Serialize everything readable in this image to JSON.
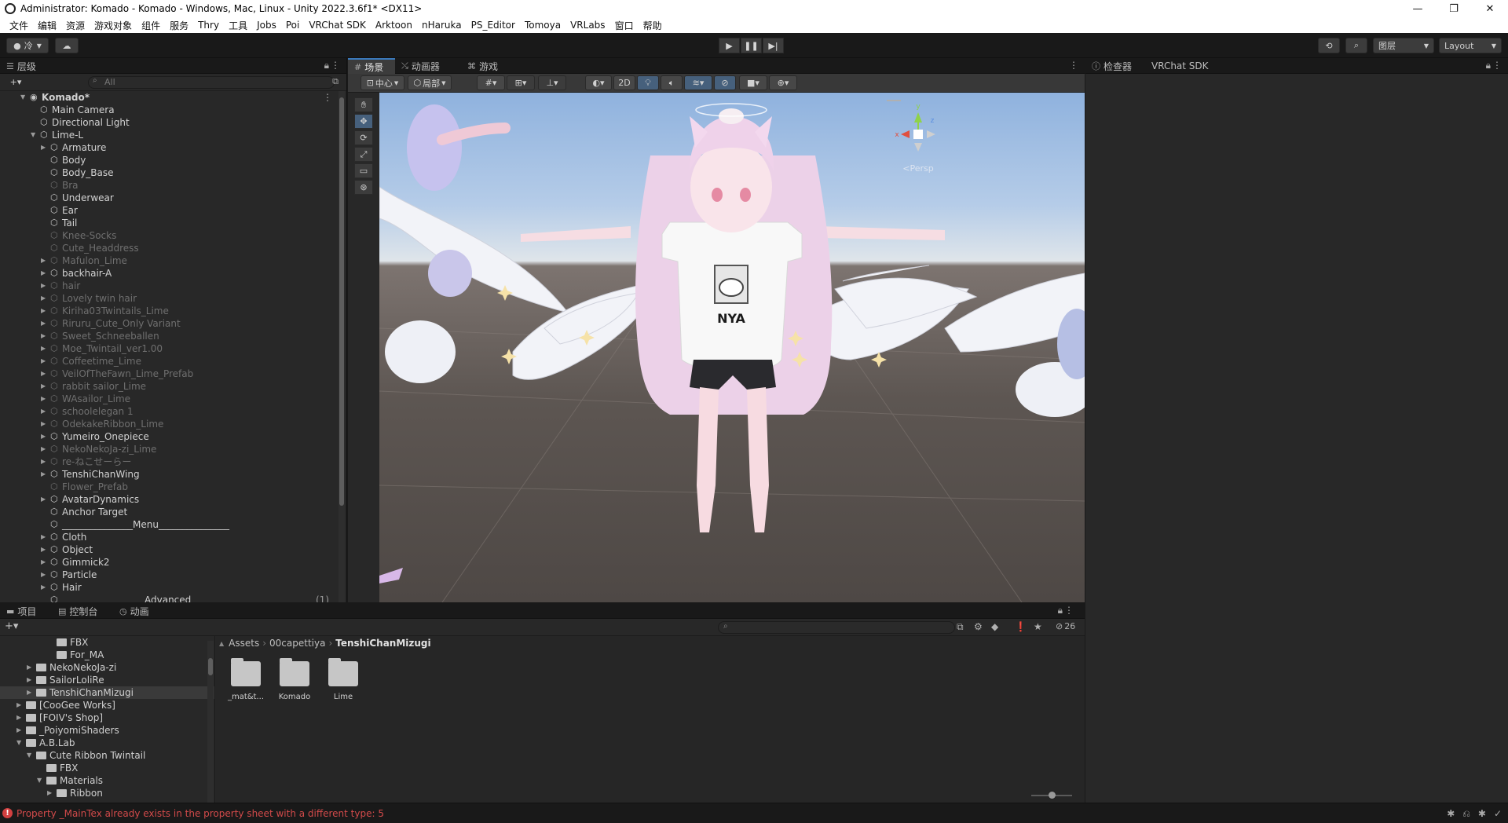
{
  "window": {
    "title": "Administrator: Komado - Komado - Windows, Mac, Linux - Unity 2022.3.6f1* <DX11>"
  },
  "menubar": {
    "items": [
      "文件",
      "编辑",
      "资源",
      "游戏对象",
      "组件",
      "服务",
      "Thry",
      "工具",
      "Jobs",
      "Poi",
      "VRChat SDK",
      "Arktoon",
      "nHaruka",
      "PS_Editor",
      "Tomoya",
      "VRLabs",
      "窗口",
      "帮助"
    ]
  },
  "toolbar": {
    "account_label": "冷",
    "layers_label": "图层",
    "layout_label": "Layout"
  },
  "hierarchy": {
    "tab_label": "层级",
    "search_placeholder": "All",
    "rows": [
      {
        "label": "Komado*",
        "depth": 0,
        "arrow": "▼",
        "dim": false,
        "scene": true
      },
      {
        "label": "Main Camera",
        "depth": 1,
        "arrow": "",
        "dim": false
      },
      {
        "label": "Directional Light",
        "depth": 1,
        "arrow": "",
        "dim": false
      },
      {
        "label": "Lime-L",
        "depth": 1,
        "arrow": "▼",
        "dim": false
      },
      {
        "label": "Armature",
        "depth": 2,
        "arrow": "▶",
        "dim": false
      },
      {
        "label": "Body",
        "depth": 2,
        "arrow": "",
        "dim": false
      },
      {
        "label": "Body_Base",
        "depth": 2,
        "arrow": "",
        "dim": false
      },
      {
        "label": "Bra",
        "depth": 2,
        "arrow": "",
        "dim": true
      },
      {
        "label": "Underwear",
        "depth": 2,
        "arrow": "",
        "dim": false
      },
      {
        "label": "Ear",
        "depth": 2,
        "arrow": "",
        "dim": false
      },
      {
        "label": "Tail",
        "depth": 2,
        "arrow": "",
        "dim": false
      },
      {
        "label": "Knee-Socks",
        "depth": 2,
        "arrow": "",
        "dim": true
      },
      {
        "label": "Cute_Headdress",
        "depth": 2,
        "arrow": "",
        "dim": true
      },
      {
        "label": "Mafulon_Lime",
        "depth": 2,
        "arrow": "▶",
        "dim": true
      },
      {
        "label": "backhair-A",
        "depth": 2,
        "arrow": "▶",
        "dim": false
      },
      {
        "label": "hair",
        "depth": 2,
        "arrow": "▶",
        "dim": true
      },
      {
        "label": "Lovely twin hair",
        "depth": 2,
        "arrow": "▶",
        "dim": true
      },
      {
        "label": "Kiriha03Twintails_Lime",
        "depth": 2,
        "arrow": "▶",
        "dim": true
      },
      {
        "label": "Riruru_Cute_Only Variant",
        "depth": 2,
        "arrow": "▶",
        "dim": true
      },
      {
        "label": "Sweet_Schneeballen",
        "depth": 2,
        "arrow": "▶",
        "dim": true
      },
      {
        "label": "Moe_Twintail_ver1.00",
        "depth": 2,
        "arrow": "▶",
        "dim": true
      },
      {
        "label": "Coffeetime_Lime",
        "depth": 2,
        "arrow": "▶",
        "dim": true
      },
      {
        "label": "VeilOfTheFawn_Lime_Prefab",
        "depth": 2,
        "arrow": "▶",
        "dim": true
      },
      {
        "label": "rabbit sailor_Lime",
        "depth": 2,
        "arrow": "▶",
        "dim": true
      },
      {
        "label": "WAsailor_Lime",
        "depth": 2,
        "arrow": "▶",
        "dim": true
      },
      {
        "label": "schoolelegan 1",
        "depth": 2,
        "arrow": "▶",
        "dim": true
      },
      {
        "label": "OdekakeRibbon_Lime",
        "depth": 2,
        "arrow": "▶",
        "dim": true
      },
      {
        "label": "Yumeiro_Onepiece",
        "depth": 2,
        "arrow": "▶",
        "dim": false
      },
      {
        "label": "NekoNekoJa-zi_Lime",
        "depth": 2,
        "arrow": "▶",
        "dim": true
      },
      {
        "label": "re-ねこせーらー",
        "depth": 2,
        "arrow": "▶",
        "dim": true
      },
      {
        "label": "TenshiChanWing",
        "depth": 2,
        "arrow": "▶",
        "dim": false
      },
      {
        "label": "Flower_Prefab",
        "depth": 2,
        "arrow": "",
        "dim": true
      },
      {
        "label": "AvatarDynamics",
        "depth": 2,
        "arrow": "▶",
        "dim": false
      },
      {
        "label": "Anchor Target",
        "depth": 2,
        "arrow": "",
        "dim": false
      },
      {
        "label": "_______________Menu_______________",
        "depth": 2,
        "arrow": "",
        "dim": false
      },
      {
        "label": "Cloth",
        "depth": 2,
        "arrow": "▶",
        "dim": false
      },
      {
        "label": "Object",
        "depth": 2,
        "arrow": "▶",
        "dim": false
      },
      {
        "label": "Gimmick2",
        "depth": 2,
        "arrow": "▶",
        "dim": false
      },
      {
        "label": "Particle",
        "depth": 2,
        "arrow": "▶",
        "dim": false
      },
      {
        "label": "Hair",
        "depth": 2,
        "arrow": "▶",
        "dim": false
      },
      {
        "label": "Advanced",
        "depth": 2,
        "arrow": "",
        "dim": false,
        "count": "(1)",
        "center": true
      }
    ]
  },
  "scene": {
    "tabs": [
      "场景",
      "动画器",
      "游戏"
    ],
    "pivot_label": "中心",
    "space_label": "局部",
    "mode_2d": "2D",
    "gizmo_axes": {
      "x": "x",
      "y": "y",
      "z": "z"
    },
    "persp_label": "<Persp",
    "shirt_text": "NYA"
  },
  "inspector": {
    "tabs": [
      "检查器",
      "VRChat SDK"
    ]
  },
  "project": {
    "tabs": [
      "项目",
      "控制台",
      "动画"
    ],
    "hidden_count": "26",
    "tree": [
      {
        "label": "FBX",
        "depth": 4,
        "arrow": "",
        "selected": false
      },
      {
        "label": "For_MA",
        "depth": 4,
        "arrow": "",
        "selected": false
      },
      {
        "label": "NekoNekoJa-zi",
        "depth": 2,
        "arrow": "▶",
        "selected": false
      },
      {
        "label": "SailorLoliRe",
        "depth": 2,
        "arrow": "▶",
        "selected": false
      },
      {
        "label": "TenshiChanMizugi",
        "depth": 2,
        "arrow": "▶",
        "selected": true
      },
      {
        "label": "[CooGee Works]",
        "depth": 1,
        "arrow": "▶",
        "selected": false
      },
      {
        "label": "[FOIV's Shop]",
        "depth": 1,
        "arrow": "▶",
        "selected": false
      },
      {
        "label": "_PoiyomiShaders",
        "depth": 1,
        "arrow": "▶",
        "selected": false
      },
      {
        "label": "A.B.Lab",
        "depth": 1,
        "arrow": "▼",
        "selected": false
      },
      {
        "label": "Cute Ribbon Twintail",
        "depth": 2,
        "arrow": "▼",
        "selected": false
      },
      {
        "label": "FBX",
        "depth": 3,
        "arrow": "",
        "selected": false
      },
      {
        "label": "Materials",
        "depth": 3,
        "arrow": "▼",
        "selected": false
      },
      {
        "label": "Ribbon",
        "depth": 4,
        "arrow": "▶",
        "selected": false
      }
    ],
    "breadcrumb": [
      "Assets",
      "00capettiya",
      "TenshiChanMizugi"
    ],
    "assets": [
      "_mat&t...",
      "Komado",
      "Lime"
    ]
  },
  "statusbar": {
    "message": "Property _MainTex already exists in the property sheet with a different type: 5"
  }
}
